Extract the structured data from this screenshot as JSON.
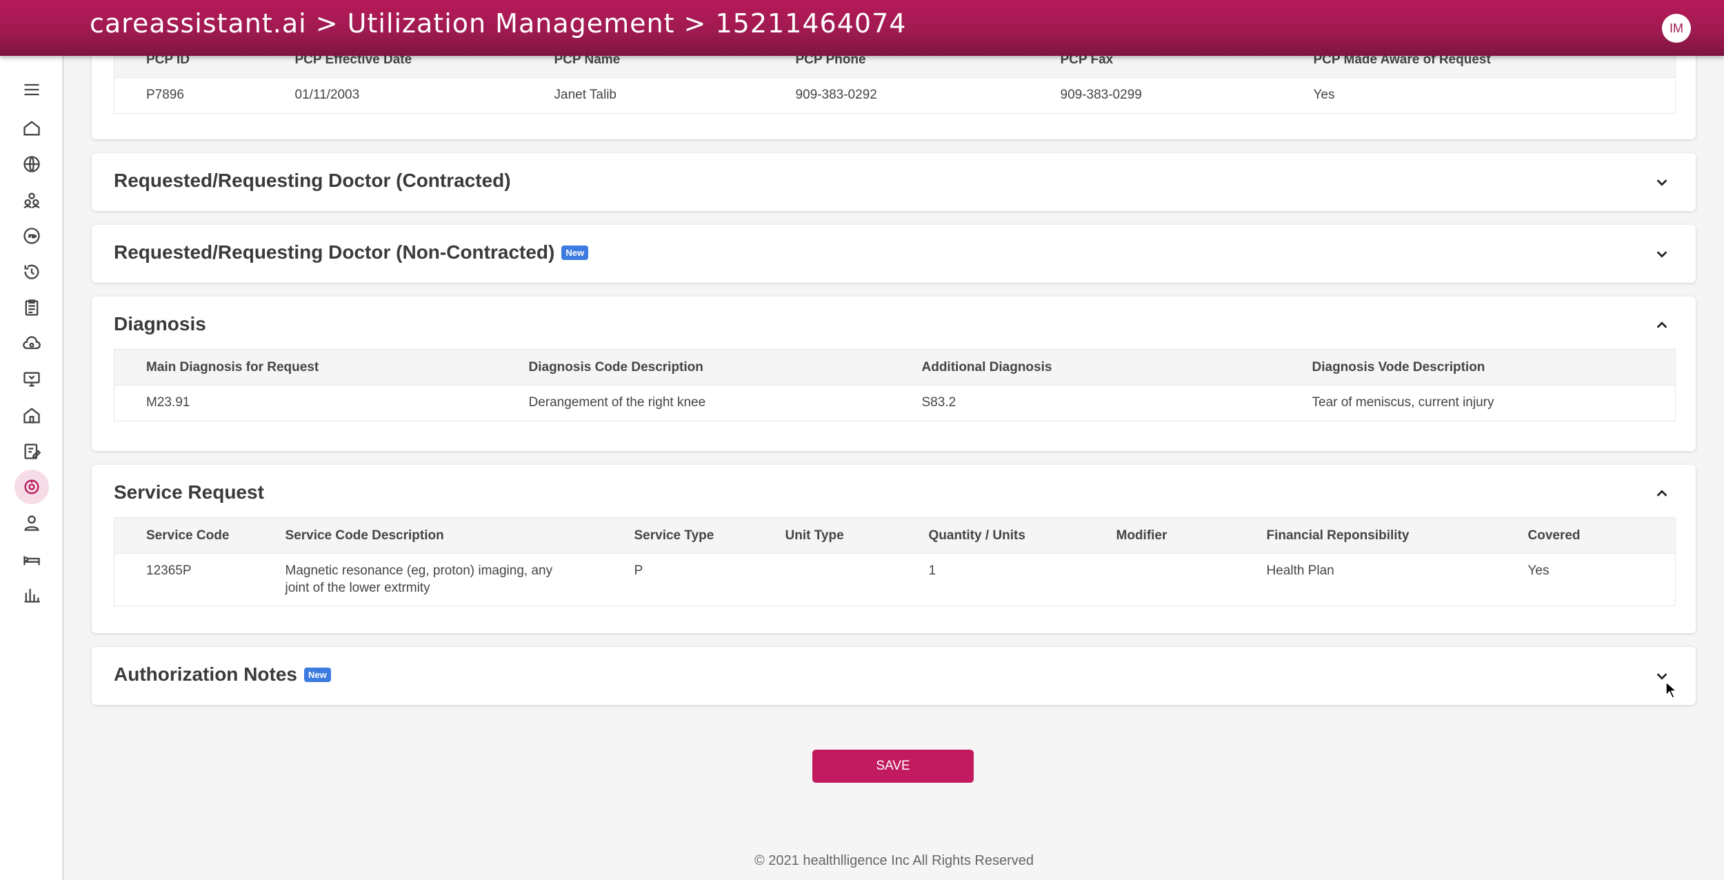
{
  "header": {
    "title": "careassistant.ai > Utilization Management > 15211464074",
    "avatar_initials": "IM"
  },
  "sidebar": {
    "icons": [
      "menu-icon",
      "home-icon",
      "globe-icon",
      "members-icon",
      "360-icon",
      "history-icon",
      "clipboard-icon",
      "cloud-camera-icon",
      "monitor-icon",
      "house-shield-icon",
      "edit-notes-icon",
      "utilization-icon",
      "user-icon",
      "bed-icon",
      "bar-chart-icon"
    ],
    "active_icon": "utilization-icon"
  },
  "pcp": {
    "headers": [
      "PCP ID",
      "PCP Effective Date",
      "PCP Name",
      "PCP Phone",
      "PCP Fax",
      "PCP Made Aware of Request"
    ],
    "row": [
      "P7896",
      "01/11/2003",
      "Janet Talib",
      "909-383-0292",
      "909-383-0299",
      "Yes"
    ]
  },
  "sections": {
    "contracted": {
      "title": "Requested/Requesting Doctor (Contracted)"
    },
    "non_contracted": {
      "title": "Requested/Requesting Doctor (Non-Contracted)",
      "badge": "New"
    },
    "diagnosis": {
      "title": "Diagnosis"
    },
    "service_request": {
      "title": "Service Request"
    },
    "auth_notes": {
      "title": "Authorization Notes",
      "badge": "New"
    }
  },
  "diagnosis": {
    "headers": [
      "Main Diagnosis for Request",
      "Diagnosis Code Description",
      "Additional Diagnosis",
      "Diagnosis Vode Description"
    ],
    "row": [
      "M23.91",
      "Derangement of the right knee",
      "S83.2",
      "Tear of meniscus, current injury"
    ]
  },
  "service": {
    "headers": [
      "Service Code",
      "Service Code Description",
      "Service Type",
      "Unit Type",
      "Quantity / Units",
      "Modifier",
      "Financial Reponsibility",
      "Covered"
    ],
    "row": [
      "12365P",
      "Magnetic resonance (eg, proton) imaging, any joint of the lower extrmity",
      "P",
      "",
      "1",
      "",
      "Health Plan",
      "Yes"
    ]
  },
  "save_label": "SAVE",
  "footer": "© 2021 healthlligence Inc All Rights Reserved",
  "colors": {
    "brand": "#b8195a",
    "badge": "#3d7be0",
    "save": "#c21a5e"
  }
}
